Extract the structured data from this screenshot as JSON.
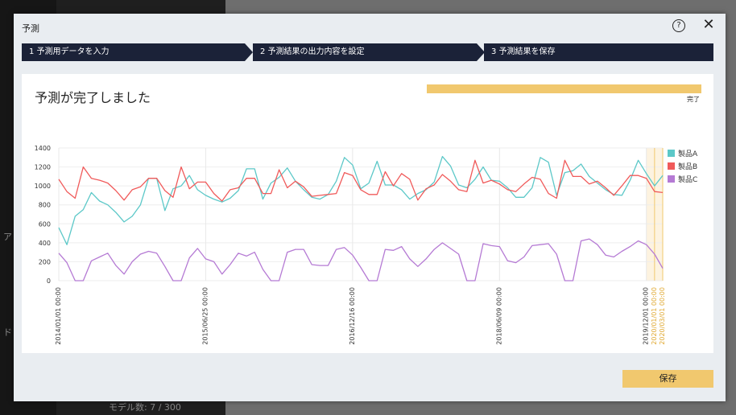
{
  "background": {
    "text_a": "ア",
    "text_d": "ド",
    "model_count": "モデル数: 7 / 300"
  },
  "dialog": {
    "title": "予測",
    "help_icon": "question-circle-icon",
    "close_icon": "close-icon",
    "steps": [
      {
        "label": "1 予測用データを入力"
      },
      {
        "label": "2 予測結果の出力内容を設定"
      },
      {
        "label": "3 予測結果を保存"
      }
    ],
    "heading": "予測が完了しました",
    "progress": {
      "percent": 100,
      "label": "完了"
    },
    "save_label": "保存"
  },
  "colors": {
    "A": "#5cc8c8",
    "B": "#f05a5a",
    "C": "#b57ad4",
    "accent": "#f1c86e",
    "step": "#1b2238"
  },
  "chart_data": {
    "type": "line",
    "ylim": [
      0,
      1400
    ],
    "yticks": [
      0,
      200,
      400,
      600,
      800,
      1000,
      1200,
      1400
    ],
    "xtick_labels": [
      "2014/01/01 00:00",
      "2015/06/25 00:00",
      "2016/12/16 00:00",
      "2018/06/09 00:00",
      "2019/12/01 00:00"
    ],
    "forecast_tick_labels": [
      "2020/01/01 00:00",
      "2020/03/01 00:00"
    ],
    "grid": true,
    "legend": "top-right",
    "series": [
      {
        "name": "製品A",
        "values": [
          560,
          380,
          680,
          750,
          930,
          840,
          800,
          720,
          620,
          680,
          800,
          1080,
          1080,
          740,
          970,
          1000,
          1110,
          960,
          900,
          860,
          830,
          870,
          950,
          1180,
          1180,
          860,
          1030,
          1090,
          1190,
          1050,
          960,
          880,
          860,
          910,
          1050,
          1300,
          1220,
          970,
          1030,
          1260,
          1010,
          1010,
          960,
          860,
          920,
          960,
          1040,
          1310,
          1210,
          1010,
          980,
          1070,
          1200,
          1060,
          1050,
          980,
          880,
          880,
          980,
          1300,
          1250,
          900,
          1140,
          1160,
          1230,
          1100,
          1030,
          960,
          910,
          900,
          1060,
          1270,
          1130,
          1000,
          1110
        ]
      },
      {
        "name": "製品B",
        "values": [
          1070,
          940,
          870,
          1200,
          1080,
          1060,
          1030,
          950,
          850,
          960,
          990,
          1080,
          1080,
          950,
          880,
          1200,
          970,
          1040,
          1040,
          920,
          840,
          960,
          980,
          1080,
          1080,
          920,
          920,
          1170,
          980,
          1050,
          990,
          890,
          900,
          910,
          920,
          1140,
          1110,
          960,
          910,
          910,
          1150,
          1000,
          1130,
          1070,
          850,
          970,
          1010,
          1120,
          1050,
          960,
          940,
          1270,
          1030,
          1060,
          1020,
          960,
          940,
          1020,
          1090,
          1070,
          920,
          870,
          1270,
          1100,
          1100,
          1020,
          1050,
          980,
          900,
          1000,
          1110,
          1110,
          1080,
          940,
          930
        ]
      },
      {
        "name": "製品C",
        "values": [
          290,
          190,
          0,
          0,
          210,
          250,
          290,
          160,
          70,
          200,
          280,
          310,
          290,
          150,
          0,
          0,
          240,
          340,
          230,
          200,
          70,
          170,
          290,
          260,
          300,
          120,
          0,
          0,
          300,
          330,
          330,
          170,
          160,
          160,
          330,
          350,
          270,
          140,
          0,
          0,
          330,
          320,
          360,
          230,
          150,
          230,
          330,
          400,
          340,
          280,
          0,
          0,
          390,
          370,
          360,
          210,
          190,
          250,
          370,
          380,
          390,
          280,
          0,
          0,
          420,
          440,
          380,
          270,
          250,
          310,
          360,
          420,
          380,
          280,
          130
        ]
      }
    ],
    "forecast_start_index": 72
  }
}
